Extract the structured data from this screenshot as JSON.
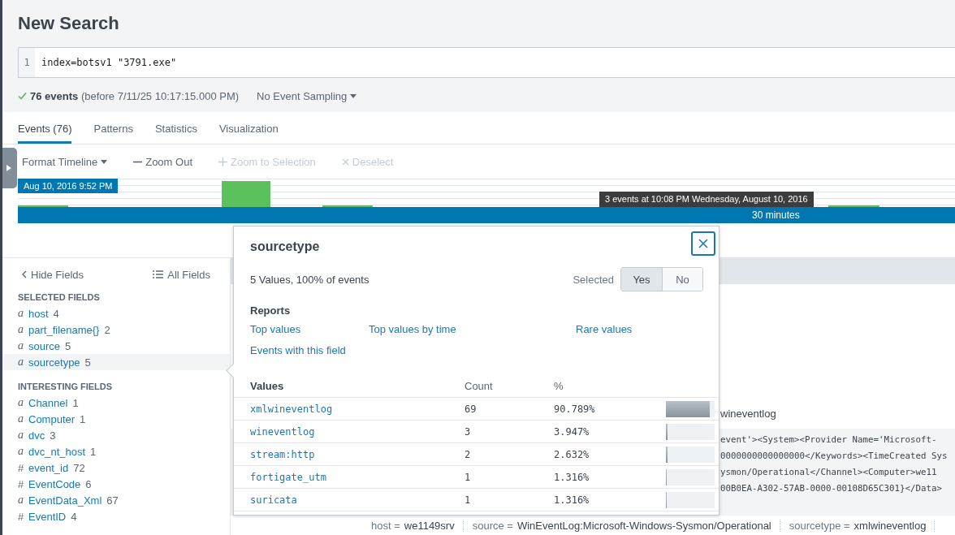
{
  "page": {
    "title": "New Search"
  },
  "search": {
    "line_number": "1",
    "query": "index=botsv1 \"3791.exe\""
  },
  "status": {
    "summary": "**76 events** (before 7/11/25 10:17:15.000 PM)",
    "sampling": "No Event Sampling"
  },
  "tabs": [
    {
      "label": "Events (76)",
      "selected": true
    },
    {
      "label": "Patterns",
      "selected": false
    },
    {
      "label": "Statistics",
      "selected": false
    },
    {
      "label": "Visualization",
      "selected": false
    }
  ],
  "toolbar": [
    {
      "kind": "dropdown",
      "label": "Format Timeline",
      "disabled": false
    },
    {
      "kind": "minus",
      "label": "Zoom Out",
      "disabled": false
    },
    {
      "kind": "plus",
      "label": "Zoom to Selection",
      "disabled": true
    },
    {
      "kind": "close",
      "label": "Deselect",
      "disabled": true
    }
  ],
  "timeline": {
    "start_label": "Aug 10, 2016 9:52 PM",
    "scale_label": "30 minutes",
    "tooltip": "3 events at 10:08 PM Wednesday, August 10, 2016"
  },
  "sidebar": {
    "hide_label": "Hide Fields",
    "all_label": "All Fields",
    "sections": [
      {
        "heading": "SELECTED FIELDS",
        "fields": [
          {
            "type": "a",
            "name": "host",
            "count": "4",
            "selected": false
          },
          {
            "type": "a",
            "name": "part_filename{}",
            "count": "2",
            "selected": false
          },
          {
            "type": "a",
            "name": "source",
            "count": "5",
            "selected": false
          },
          {
            "type": "a",
            "name": "sourcetype",
            "count": "5",
            "selected": true
          }
        ]
      },
      {
        "heading": "INTERESTING FIELDS",
        "fields": [
          {
            "type": "a",
            "name": "Channel",
            "count": "1",
            "selected": false
          },
          {
            "type": "a",
            "name": "Computer",
            "count": "1",
            "selected": false
          },
          {
            "type": "a",
            "name": "dvc",
            "count": "3",
            "selected": false
          },
          {
            "type": "a",
            "name": "dvc_nt_host",
            "count": "1",
            "selected": false
          },
          {
            "type": "#",
            "name": "event_id",
            "count": "72",
            "selected": false
          },
          {
            "type": "#",
            "name": "EventCode",
            "count": "6",
            "selected": false
          },
          {
            "type": "a",
            "name": "EventData_Xml",
            "count": "67",
            "selected": false
          },
          {
            "type": "#",
            "name": "EventID",
            "count": "4",
            "selected": false
          }
        ]
      }
    ]
  },
  "event": {
    "sourcetype_tail": "wineventlog",
    "raw_lines": [
      "event'><System><Provider Name='Microsoft-",
      "0000000000000000</Keywords><TimeCreated Sys",
      "ysmon/Operational</Channel><Computer>we11",
      "00B0EA-A302-57AB-0000-00108D65C301}</Data>"
    ],
    "meta": [
      {
        "key": "host =",
        "value": "we1149srv"
      },
      {
        "key": "source =",
        "value": "WinEventLog:Microsoft-Windows-Sysmon/Operational"
      },
      {
        "key": "sourcetype =",
        "value": "xmlwineventlog"
      }
    ]
  },
  "popover": {
    "title": "sourcetype",
    "summary": "5 Values, 100% of events",
    "selected_label": "Selected",
    "selected_options": [
      {
        "label": "Yes",
        "selected": true
      },
      {
        "label": "No",
        "selected": false
      }
    ],
    "reports_heading": "Reports",
    "reports": [
      "Top values",
      "Top values by time",
      "Rare values",
      "Events with this field"
    ],
    "columns": [
      "Values",
      "Count",
      "%"
    ],
    "values": [
      {
        "value": "xmlwineventlog",
        "count": "69",
        "percent": "90.789%",
        "level": 0.908
      },
      {
        "value": "wineventlog",
        "count": "3",
        "percent": "3.947%",
        "level": 0.039
      },
      {
        "value": "stream:http",
        "count": "2",
        "percent": "2.632%",
        "level": 0.026
      },
      {
        "value": "fortigate_utm",
        "count": "1",
        "percent": "1.316%",
        "level": 0.013
      },
      {
        "value": "suricata",
        "count": "1",
        "percent": "1.316%",
        "level": 0.013
      }
    ]
  }
}
